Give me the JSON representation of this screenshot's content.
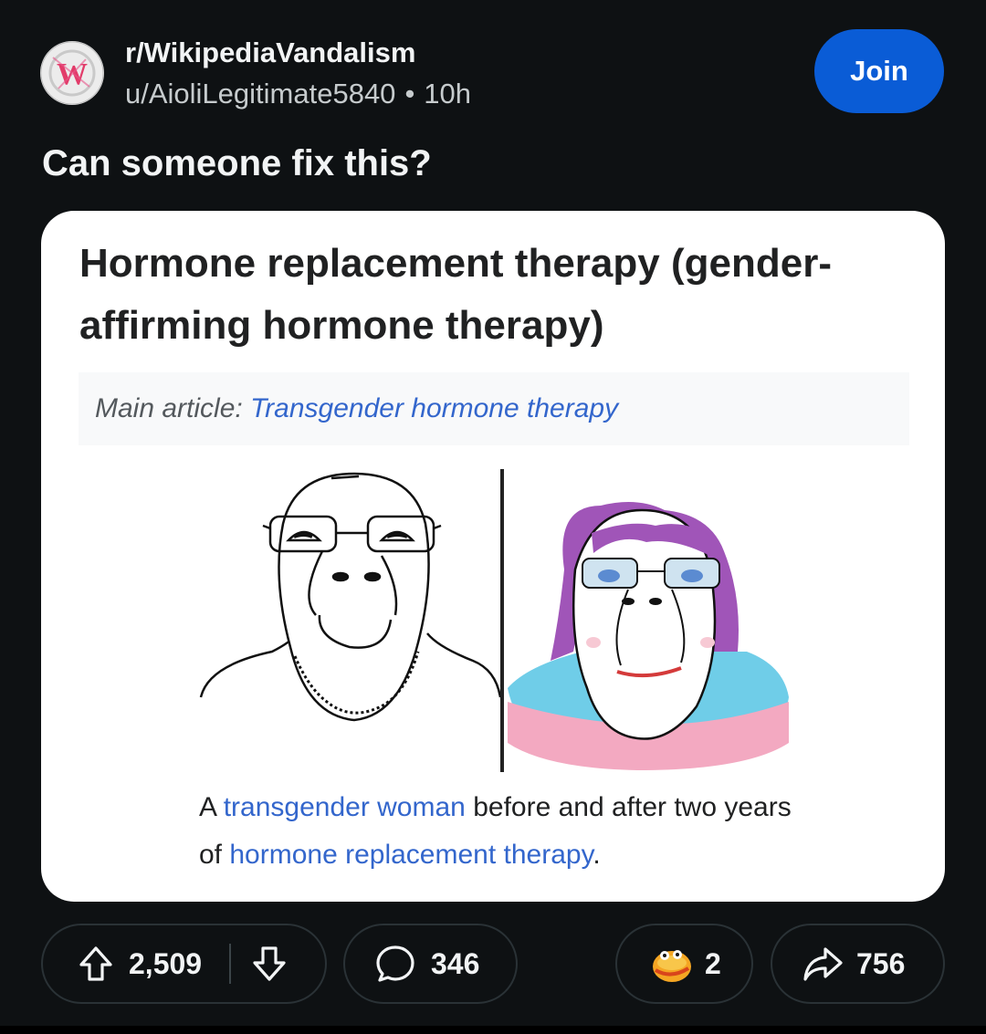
{
  "post": {
    "subreddit": "r/WikipediaVandalism",
    "username": "u/AioliLegitimate5840",
    "separator": "•",
    "age": "10h",
    "join_label": "Join",
    "title": "Can someone fix this?"
  },
  "embedded_image": {
    "heading": "Hormone replacement therapy (gender-affirming hormone therapy)",
    "hatnote_prefix": "Main article:",
    "hatnote_link": "Transgender hormone therapy",
    "caption_part1": "A ",
    "caption_link1": "transgender woman",
    "caption_part2": " before and after two years of ",
    "caption_link2": "hormone replacement therapy",
    "caption_part3": "."
  },
  "actions": {
    "upvotes": "2,509",
    "comments": "346",
    "awards": "2",
    "shares": "756"
  },
  "colors": {
    "background": "#0e1113",
    "join_button": "#0a5cd6",
    "wiki_link": "#3366cc",
    "hair": "#a055b8",
    "shirt_blue": "#6fcde8",
    "shirt_pink": "#f3a9c1"
  },
  "icons": [
    "wikipedia-subreddit-avatar",
    "upvote-icon",
    "downvote-icon",
    "comment-icon",
    "award-icon",
    "share-icon"
  ]
}
